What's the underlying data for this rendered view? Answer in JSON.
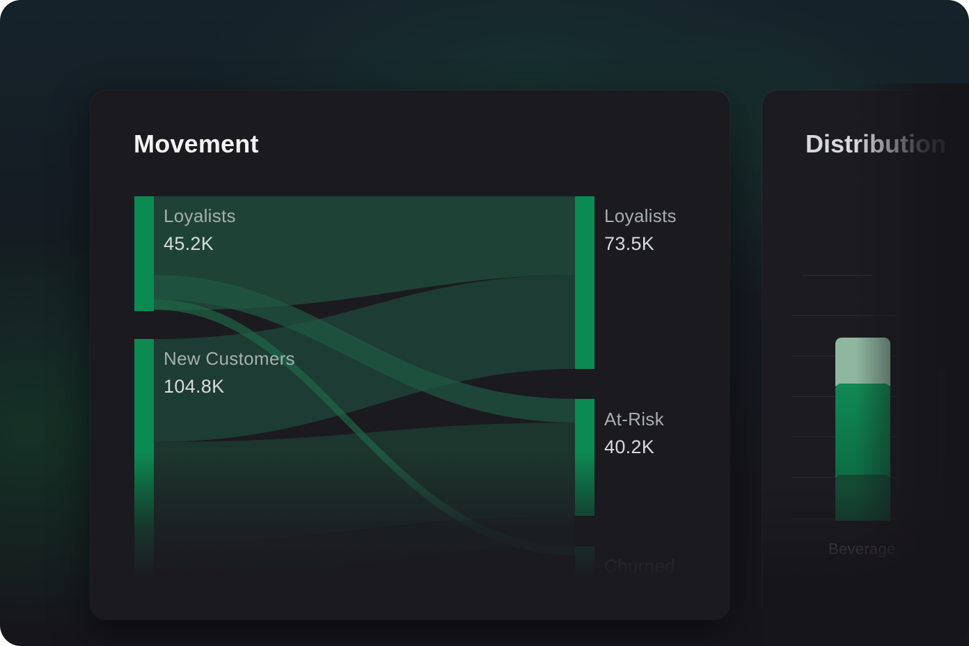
{
  "movement_card": {
    "title": "Movement",
    "sources": [
      {
        "label": "Loyalists",
        "value": "45.2K"
      },
      {
        "label": "New Customers",
        "value": "104.8K"
      }
    ],
    "targets": [
      {
        "label": "Loyalists",
        "value": "73.5K"
      },
      {
        "label": "At-Risk",
        "value": "40.2K"
      },
      {
        "label": "Churned",
        "value": ""
      }
    ],
    "colors": {
      "node": "#0b8a52",
      "link": "#1f5c44"
    }
  },
  "distribution_card": {
    "title": "Distribution",
    "x_tick": "Beverage",
    "colors": {
      "top": "#8fb7a0",
      "middle": "#0f7a4c",
      "bottom": "#124a33"
    }
  },
  "chart_data": [
    {
      "type": "sankey",
      "title": "Movement",
      "nodes": [
        "Loyalists",
        "New Customers",
        "Loyalists",
        "At-Risk",
        "Churned"
      ],
      "node_values": {
        "source_Loyalists": 45.2,
        "source_New Customers": 104.8,
        "target_Loyalists": 73.5,
        "target_At-Risk": 40.2
      },
      "unit": "K",
      "links": [
        {
          "source": "Loyalists",
          "target": "Loyalists"
        },
        {
          "source": "Loyalists",
          "target": "At-Risk"
        },
        {
          "source": "Loyalists",
          "target": "Churned"
        },
        {
          "source": "New Customers",
          "target": "Loyalists"
        },
        {
          "source": "New Customers",
          "target": "At-Risk"
        },
        {
          "source": "New Customers",
          "target": "Churned"
        }
      ]
    },
    {
      "type": "bar",
      "title": "Distribution",
      "categories": [
        "Beverage"
      ],
      "stacked": true
    }
  ]
}
